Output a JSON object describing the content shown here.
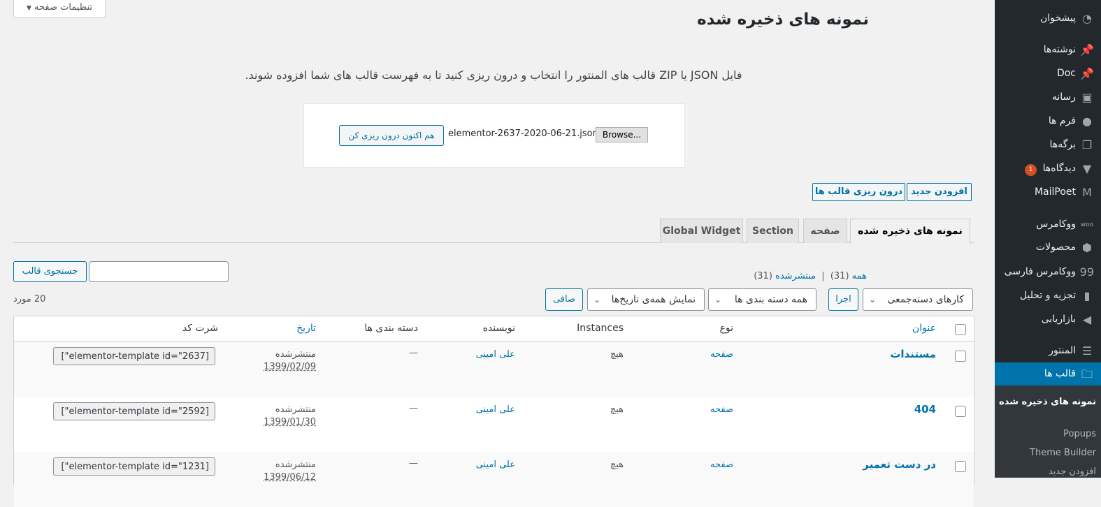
{
  "sidebar": {
    "items": [
      {
        "label": "پیشخوان",
        "icon": "dashboard-icon"
      },
      {
        "label": "نوشته‌ها",
        "icon": "pin-icon"
      },
      {
        "label": "Doc",
        "icon": "pin-icon"
      },
      {
        "label": "رسانه",
        "icon": "media-icon"
      },
      {
        "label": "فرم ها",
        "icon": "forms-icon"
      },
      {
        "label": "برگه‌ها",
        "icon": "pages-icon"
      },
      {
        "label": "دیدگاه‌ها",
        "icon": "comments-icon",
        "badge": "1"
      },
      {
        "label": "MailPoet",
        "icon": "mailpoet-icon"
      },
      {
        "label": "ووکامرس",
        "icon": "woo-icon"
      },
      {
        "label": "محصولات",
        "icon": "products-icon"
      },
      {
        "label": "ووکامرس فارسی",
        "icon": "woo-persian-icon"
      },
      {
        "label": "تجزیه و تحلیل",
        "icon": "analytics-icon"
      },
      {
        "label": "بازاریابی",
        "icon": "marketing-icon"
      },
      {
        "label": "المنتور",
        "icon": "elementor-icon"
      },
      {
        "label": "قالب ها",
        "icon": "folder-icon"
      }
    ],
    "submenu": [
      {
        "label": "نمونه های ذخیره شده"
      },
      {
        "label": "Popups"
      },
      {
        "label": "Theme Builder"
      },
      {
        "label": "افزودن جدید"
      }
    ]
  },
  "header": {
    "screen_options": "تنظیمات صفحه",
    "page_title": "نمونه های ذخیره شده"
  },
  "import": {
    "description": "فایل JSON یا ZIP قالب های المنتور را انتخاب و درون ریزی کنید تا به فهرست قالب های شما افزوده شوند.",
    "browse_label": "Browse...",
    "file_name": "elementor-2637-2020-06-21.json",
    "import_button": "هم اکنون درون ریزی کن"
  },
  "actions": {
    "add_new": "افزودن جدید",
    "import_templates": "درون ریزی قالب ها"
  },
  "tabs": [
    {
      "label": "نمونه های ذخیره شده",
      "active": true
    },
    {
      "label": "صفحه",
      "active": false
    },
    {
      "label": "Section",
      "active": false
    },
    {
      "label": "Global Widget",
      "active": false
    }
  ],
  "filters": {
    "all_label": "همه",
    "all_count": "(31)",
    "separator": "|",
    "published_label": "منتشرشده",
    "published_count": "(31)",
    "search_button": "جستجوی قالب",
    "bulk_actions": "کارهای دسته‌جمعی",
    "apply": "اجرا",
    "categories": "همه دسته بندی ها",
    "dates": "نمایش همه‌ی تاریخ‌ها",
    "filter": "صافی",
    "items_count": "20 مورد"
  },
  "table": {
    "columns": {
      "title": "عنوان",
      "type": "نوع",
      "instances": "Instances",
      "author": "نویسنده",
      "categories": "دسته بندی ها",
      "date": "تاریخ",
      "shortcode": "شرت کد"
    },
    "rows": [
      {
        "title": "مستندات",
        "type": "صفحه",
        "instances": "هیچ",
        "author": "علی امینی",
        "categories": "—",
        "status": "منتشرشده",
        "date": "1399/02/09",
        "shortcode": "[elementor-template id=\"2637\"]"
      },
      {
        "title": "404",
        "type": "صفحه",
        "instances": "هیچ",
        "author": "علی امینی",
        "categories": "—",
        "status": "منتشرشده",
        "date": "1399/01/30",
        "shortcode": "[elementor-template id=\"2592\"]"
      },
      {
        "title": "در دست تعمیر",
        "type": "صفحه",
        "instances": "هیچ",
        "author": "علی امینی",
        "categories": "—",
        "status": "منتشرشده",
        "date": "1399/06/12",
        "shortcode": "[elementor-template id=\"1231\"]"
      }
    ]
  },
  "colors": {
    "menu_bg": "#23282d",
    "menu_current": "#0073aa",
    "link": "#0073aa",
    "badge": "#d54e21"
  }
}
